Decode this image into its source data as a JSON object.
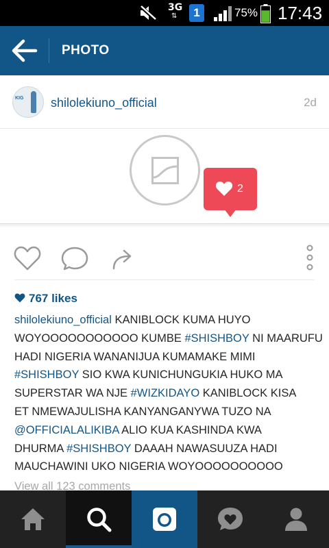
{
  "status_bar": {
    "network_label": "3G",
    "network_arrows": "⇅",
    "sim_slot": "1",
    "battery_percent": "75%",
    "battery_level": 0.75,
    "time": "17:43",
    "icons": [
      "mute-icon",
      "signal-icon",
      "battery-icon"
    ]
  },
  "app_bar": {
    "title": "PHOTO",
    "back_icon": "back-arrow-icon",
    "background_color": "#125688"
  },
  "post": {
    "username": "shilolekiuno_official",
    "age": "2d",
    "avatar_text": "KIG",
    "photo_placeholder_icon": "image-placeholder-icon",
    "like_notification": {
      "icon": "heart-icon",
      "count": "2",
      "color": "#ed4956"
    },
    "actions": {
      "like_icon": "heart-outline-icon",
      "comment_icon": "comment-icon",
      "share_icon": "share-icon",
      "more_icon": "more-vertical-icon"
    },
    "likes_text": "767 likes",
    "caption_lines": [
      [
        {
          "t": "shilolekiuno_official",
          "link": true
        },
        {
          "t": " KANIBLOCK KUMA HUYO",
          "link": false
        }
      ],
      [
        {
          "t": "WOYOOOOOOOOOOO KUMBE ",
          "link": false
        },
        {
          "t": "#SHISHBOY",
          "link": true
        },
        {
          "t": " NI MAARUFU",
          "link": false
        }
      ],
      [
        {
          "t": "HADI NIGERIA WANANIJUA KUMAMAKE MIMI",
          "link": false
        }
      ],
      [
        {
          "t": "#SHISHBOY",
          "link": true
        },
        {
          "t": " SIO KWA KUNICHUNGUKIA HUKO MA",
          "link": false
        }
      ],
      [
        {
          "t": "SUPERSTAR WA NJE ",
          "link": false
        },
        {
          "t": "#WIZKIDAYO",
          "link": true
        },
        {
          "t": " KANIBLOCK KISA",
          "link": false
        }
      ],
      [
        {
          "t": "ET NMEWAJULISHA KANYANGANYWA TUZO NA",
          "link": false
        }
      ],
      [
        {
          "t": "@OFFICIALALIKIBA",
          "link": true
        },
        {
          "t": " ALIO KUA KASHINDA KWA",
          "link": false
        }
      ],
      [
        {
          "t": "DHURMA ",
          "link": false
        },
        {
          "t": "#SHISHBOY",
          "link": true
        },
        {
          "t": " DAAAH NAWASUUZA HADI",
          "link": false
        }
      ],
      [
        {
          "t": "MAUCHAWINI UKO NIGERIA WOYOOOOOOOOOO",
          "link": false
        }
      ]
    ],
    "view_comments": "View all 123 comments"
  },
  "bottom_nav": {
    "items": [
      {
        "icon": "home-icon",
        "active": false
      },
      {
        "icon": "search-icon",
        "active": true
      },
      {
        "icon": "camera-icon",
        "active": false
      },
      {
        "icon": "activity-heart-icon",
        "active": false
      },
      {
        "icon": "profile-icon",
        "active": false
      }
    ]
  }
}
